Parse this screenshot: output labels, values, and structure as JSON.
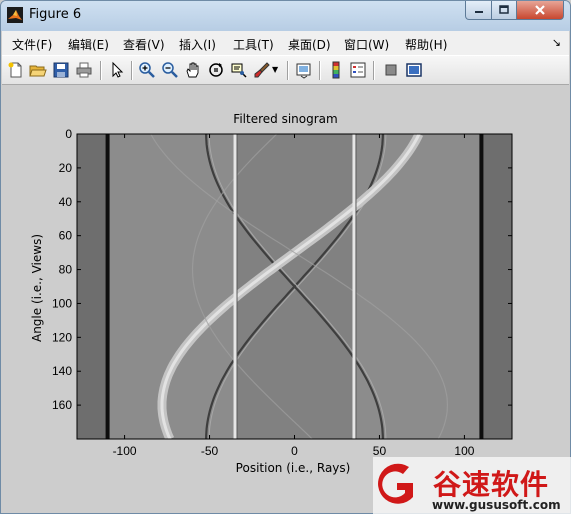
{
  "window": {
    "title": "Figure 6"
  },
  "menu": {
    "items": [
      "文件(F)",
      "编辑(E)",
      "查看(V)",
      "插入(I)",
      "工具(T)",
      "桌面(D)",
      "窗口(W)",
      "帮助(H)"
    ]
  },
  "toolbar": {
    "icons": [
      "new-figure-icon",
      "open-file-icon",
      "save-icon",
      "print-icon",
      "pointer-icon",
      "zoom-in-icon",
      "zoom-out-icon",
      "pan-icon",
      "rotate-3d-icon",
      "data-cursor-icon",
      "brush-icon",
      "link-plot-icon",
      "colorbar-icon",
      "legend-icon",
      "hide-plot-tools-icon",
      "show-plot-tools-icon"
    ]
  },
  "chart_data": {
    "type": "heatmap",
    "title": "Filtered sinogram",
    "xlabel": "Position (i.e., Rays)",
    "ylabel": "Angle (i.e., Views)",
    "xlim": [
      -128,
      128
    ],
    "ylim": [
      180,
      0
    ],
    "x_ticks": [
      "-100",
      "-50",
      "0",
      "50",
      "100"
    ],
    "x_tick_values": [
      -100,
      -50,
      0,
      50,
      100
    ],
    "y_ticks": [
      "0",
      "20",
      "40",
      "60",
      "80",
      "100",
      "120",
      "140",
      "160"
    ],
    "y_tick_values": [
      0,
      20,
      40,
      60,
      80,
      100,
      120,
      140,
      160
    ],
    "colormap": "gray",
    "features": {
      "dark_vertical_lines_x": [
        -110,
        110
      ],
      "bright_vertical_lines_x": [
        -35,
        35
      ],
      "sinusoids": [
        {
          "amplitude": 52,
          "phase_deg": 0,
          "tone": "dark"
        },
        {
          "amplitude": 52,
          "phase_deg": 180,
          "tone": "dark"
        },
        {
          "amplitude": 78,
          "phase_deg": 20,
          "tone": "bright-band"
        },
        {
          "amplitude": 90,
          "phase_deg": 200,
          "tone": "faint"
        },
        {
          "amplitude": 60,
          "phase_deg": 100,
          "tone": "faint"
        }
      ]
    }
  },
  "watermark": {
    "text": "谷速软件",
    "url": "www.gususoft.com"
  }
}
